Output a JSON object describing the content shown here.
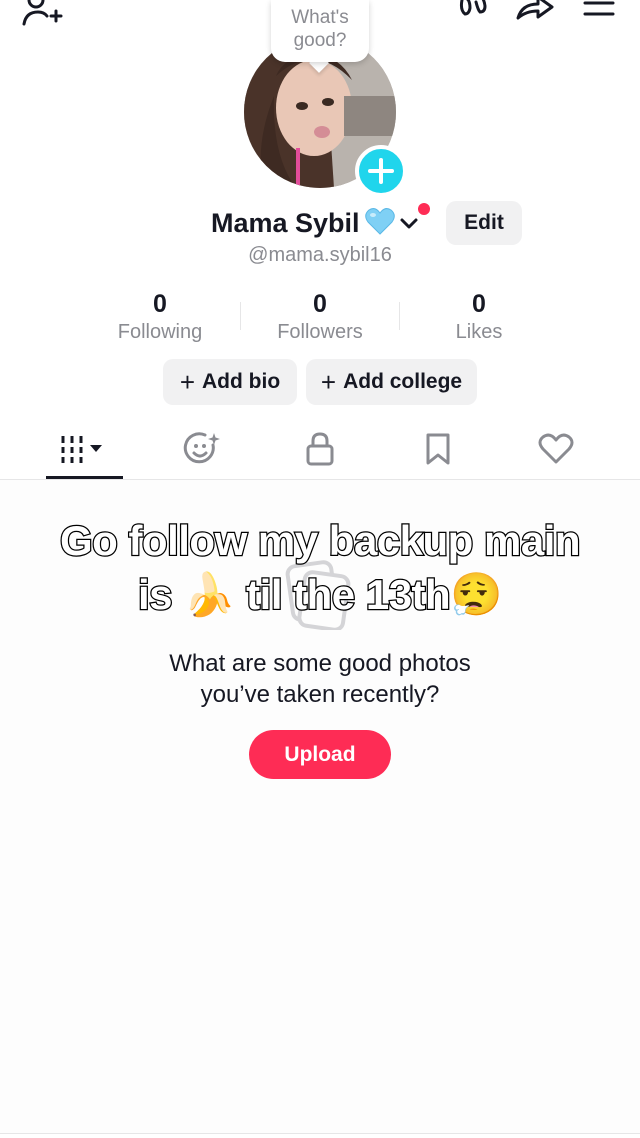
{
  "header": {
    "bubble_line1": "What's",
    "bubble_line2": "good?"
  },
  "profile": {
    "name": "Mama Sybil",
    "name_emoji": "blue-heart",
    "edit_label": "Edit",
    "username": "@mama.sybil16"
  },
  "stats": [
    {
      "value": "0",
      "label": "Following"
    },
    {
      "value": "0",
      "label": "Followers"
    },
    {
      "value": "0",
      "label": "Likes"
    }
  ],
  "actions": {
    "add_bio": "Add bio",
    "add_college": "Add college",
    "plus": "+"
  },
  "tabs": [
    {
      "icon": "grid-icon",
      "selected": true
    },
    {
      "icon": "sparkle-face-icon",
      "selected": false
    },
    {
      "icon": "lock-icon",
      "selected": false
    },
    {
      "icon": "bookmark-icon",
      "selected": false
    },
    {
      "icon": "heart-outline-icon",
      "selected": false
    }
  ],
  "overlay": {
    "line1": "Go follow my backup main",
    "line2_part1": "is",
    "line2_emoji": "🍌",
    "line2_part2": "til the 13th",
    "line2_emoji2": "😮‍💨"
  },
  "empty_state": {
    "line1": "What are some good photos",
    "line2": "you’ve taken recently?",
    "upload_label": "Upload"
  },
  "colors": {
    "accent": "#fe2c55",
    "add_avatar": "#20d5ec",
    "muted_text": "#8a8b91",
    "pill_bg": "#f1f1f2"
  }
}
